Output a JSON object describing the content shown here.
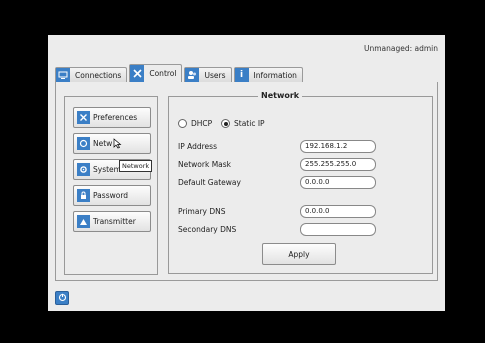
{
  "header": {
    "status": "Unmanaged: admin"
  },
  "tabs": [
    {
      "label": "Connections",
      "icon": "monitor-icon"
    },
    {
      "label": "Control",
      "icon": "tools-icon"
    },
    {
      "label": "Users",
      "icon": "users-icon"
    },
    {
      "label": "Information",
      "icon": "info-icon"
    }
  ],
  "active_tab": "Control",
  "sidebar": {
    "items": [
      {
        "label": "Preferences",
        "icon": "tools-icon"
      },
      {
        "label": "Network",
        "icon": "network-icon"
      },
      {
        "label": "System",
        "icon": "system-icon"
      },
      {
        "label": "Password",
        "icon": "lock-icon"
      },
      {
        "label": "Transmitter",
        "icon": "transmitter-icon"
      }
    ],
    "tooltip": "Network",
    "network_label_visible": "Netw"
  },
  "network": {
    "title": "Network",
    "dhcp_label": "DHCP",
    "static_label": "Static IP",
    "mode": "Static IP",
    "fields": {
      "ip_label": "IP Address",
      "ip_value": "192.168.1.2",
      "mask_label": "Network Mask",
      "mask_value": "255.255.255.0",
      "gateway_label": "Default Gateway",
      "gateway_value": "0.0.0.0",
      "dns1_label": "Primary DNS",
      "dns1_value": "0.0.0.0",
      "dns2_label": "Secondary DNS",
      "dns2_value": ""
    },
    "apply_label": "Apply"
  },
  "colors": {
    "accent": "#3b7fc6",
    "background": "#ececec"
  }
}
